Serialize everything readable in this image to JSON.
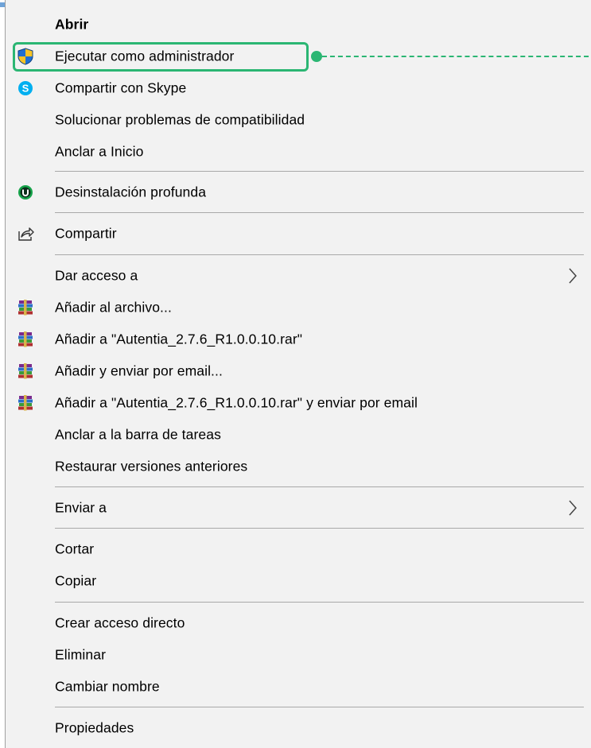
{
  "colors": {
    "menu_bg": "#f2f2f2",
    "separator": "#a9a9a9",
    "highlight": "#2bb673",
    "shield_blue": "#1f6fd1",
    "shield_yellow": "#f7c325",
    "skype_blue": "#00aff0",
    "uninstall_green": "#16a34a"
  },
  "menu": {
    "items": [
      {
        "label": "Abrir",
        "icon": "",
        "bold": true
      },
      {
        "label": "Ejecutar como administrador",
        "icon": "uac-shield-icon"
      },
      {
        "label": "Compartir con Skype",
        "icon": "skype-icon"
      },
      {
        "label": "Solucionar problemas de compatibilidad",
        "icon": ""
      },
      {
        "label": "Anclar a Inicio",
        "icon": ""
      },
      {
        "label": "Desinstalación profunda",
        "icon": "uninstaller-icon"
      },
      {
        "label": "Compartir",
        "icon": "share-icon"
      },
      {
        "label": "Dar acceso a",
        "icon": "",
        "submenu": true
      },
      {
        "label": "Añadir al archivo...",
        "icon": "winrar-icon"
      },
      {
        "label": "Añadir a \"Autentia_2.7.6_R1.0.0.10.rar\"",
        "icon": "winrar-icon"
      },
      {
        "label": "Añadir y enviar por email...",
        "icon": "winrar-icon"
      },
      {
        "label": "Añadir a \"Autentia_2.7.6_R1.0.0.10.rar\" y enviar por email",
        "icon": "winrar-icon"
      },
      {
        "label": "Anclar a la barra de tareas",
        "icon": ""
      },
      {
        "label": "Restaurar versiones anteriores",
        "icon": ""
      },
      {
        "label": "Enviar a",
        "icon": "",
        "submenu": true
      },
      {
        "label": "Cortar",
        "icon": ""
      },
      {
        "label": "Copiar",
        "icon": ""
      },
      {
        "label": "Crear acceso directo",
        "icon": ""
      },
      {
        "label": "Eliminar",
        "icon": ""
      },
      {
        "label": "Cambiar nombre",
        "icon": ""
      },
      {
        "label": "Propiedades",
        "icon": ""
      }
    ]
  }
}
